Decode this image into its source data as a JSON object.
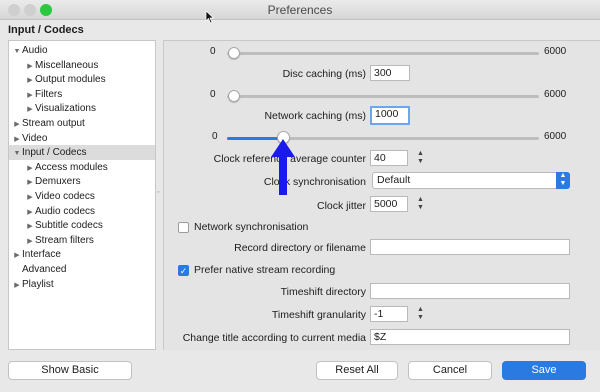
{
  "window": {
    "title": "Preferences"
  },
  "section_title": "Input / Codecs",
  "tree": {
    "items": [
      {
        "label": "Audio",
        "arrow": "▼",
        "indent": 0
      },
      {
        "label": "Miscellaneous",
        "arrow": "▶",
        "indent": 1
      },
      {
        "label": "Output modules",
        "arrow": "▶",
        "indent": 1
      },
      {
        "label": "Filters",
        "arrow": "▶",
        "indent": 1
      },
      {
        "label": "Visualizations",
        "arrow": "▶",
        "indent": 1
      },
      {
        "label": "Stream output",
        "arrow": "▶",
        "indent": 0
      },
      {
        "label": "Video",
        "arrow": "▶",
        "indent": 0
      },
      {
        "label": "Input / Codecs",
        "arrow": "▼",
        "indent": 0,
        "selected": true
      },
      {
        "label": "Access modules",
        "arrow": "▶",
        "indent": 1
      },
      {
        "label": "Demuxers",
        "arrow": "▶",
        "indent": 1
      },
      {
        "label": "Video codecs",
        "arrow": "▶",
        "indent": 1
      },
      {
        "label": "Audio codecs",
        "arrow": "▶",
        "indent": 1
      },
      {
        "label": "Subtitle codecs",
        "arrow": "▶",
        "indent": 1
      },
      {
        "label": "Stream filters",
        "arrow": "▶",
        "indent": 1
      },
      {
        "label": "Interface",
        "arrow": "▶",
        "indent": 0
      },
      {
        "label": "Advanced",
        "arrow": "",
        "indent": 0
      },
      {
        "label": "Playlist",
        "arrow": "▶",
        "indent": 0
      }
    ]
  },
  "settings": {
    "disc_slider": {
      "min": "0",
      "max": "6000",
      "value": 300
    },
    "disc_caching": {
      "label": "Disc caching (ms)",
      "value": "300"
    },
    "network_slider": {
      "min": "0",
      "max": "6000",
      "value": 0
    },
    "network_caching": {
      "label": "Network caching (ms)",
      "value": "1000"
    },
    "clock_slider": {
      "min": "0",
      "max": "6000",
      "value": 1000
    },
    "clock_reference": {
      "label": "Clock reference average counter",
      "value": "40"
    },
    "clock_sync": {
      "label": "Clock synchronisation",
      "value": "Default"
    },
    "clock_jitter": {
      "label": "Clock jitter",
      "value": "5000"
    },
    "network_sync": {
      "label": "Network synchronisation",
      "checked": false
    },
    "record_dir": {
      "label": "Record directory or filename",
      "value": ""
    },
    "prefer_native": {
      "label": "Prefer native stream recording",
      "checked": true
    },
    "timeshift_dir": {
      "label": "Timeshift directory",
      "value": ""
    },
    "timeshift_gran": {
      "label": "Timeshift granularity",
      "value": "-1"
    },
    "change_title": {
      "label": "Change title according to current media",
      "value": "$Z"
    }
  },
  "buttons": {
    "show_basic": "Show Basic",
    "reset_all": "Reset All",
    "cancel": "Cancel",
    "save": "Save"
  },
  "colors": {
    "accent": "#2a7ae2",
    "arrow_annotation": "#1a1aee"
  }
}
